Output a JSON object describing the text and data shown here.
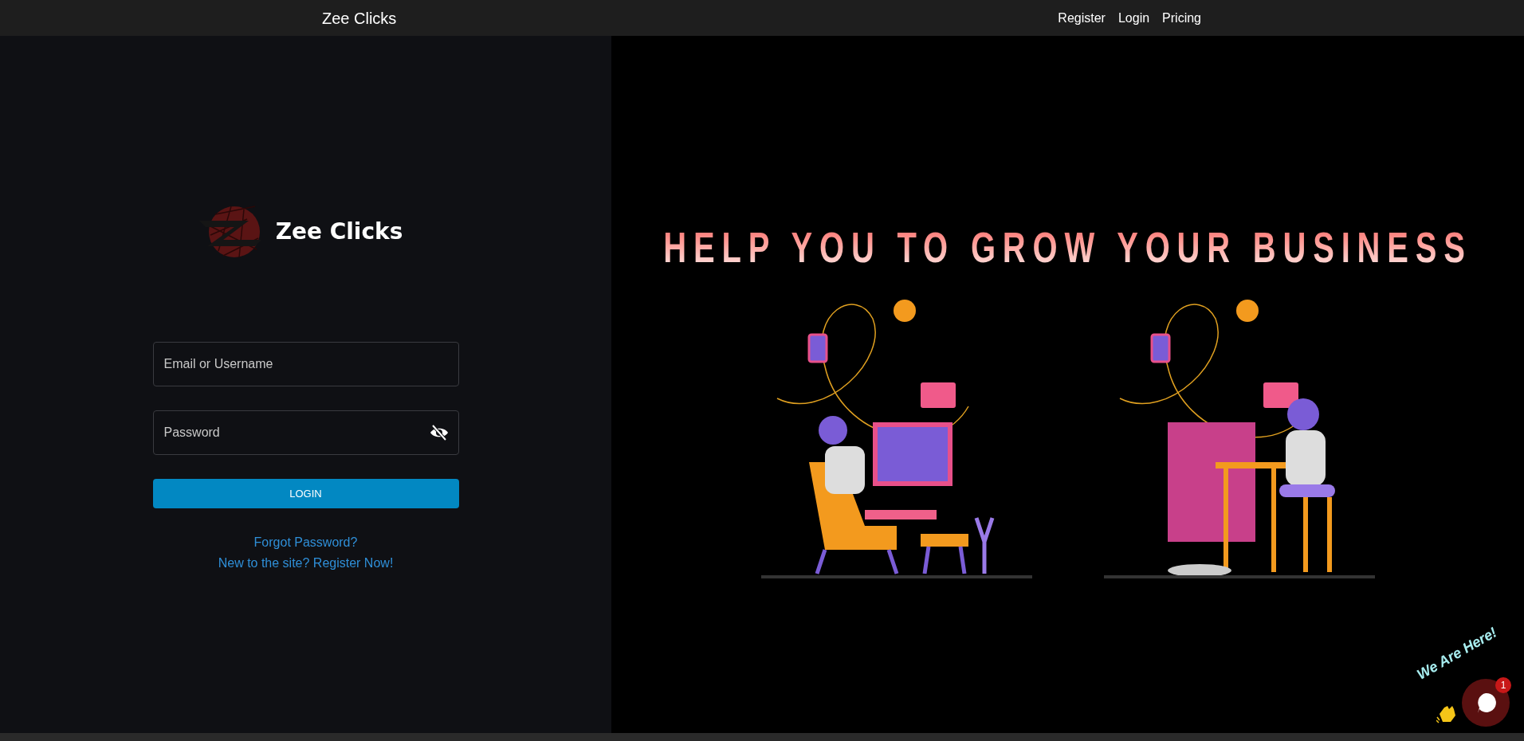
{
  "navbar": {
    "brand": "Zee Clicks",
    "links": [
      "Register",
      "Login",
      "Pricing"
    ]
  },
  "login": {
    "brand": "Zee Clicks",
    "fields": [
      {
        "kind": "text",
        "placeholder": "Email or Username"
      },
      {
        "kind": "password",
        "placeholder": "Password"
      }
    ],
    "button": "LOGIN",
    "links": [
      "Forgot Password?",
      "New to the site? Register Now!"
    ]
  },
  "hero": {
    "headline": "HELP YOU TO GROW YOUR BUSINESS"
  },
  "chat": {
    "greeting": "We Are Here!",
    "badge": "1"
  }
}
